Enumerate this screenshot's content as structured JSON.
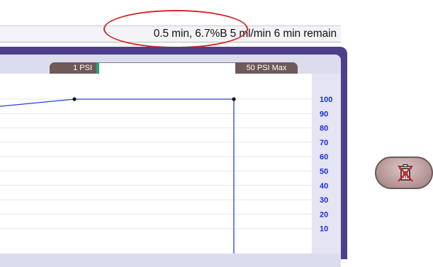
{
  "status": {
    "text": "0.5 min, 6.7%B 5 ml/min 6 min remain"
  },
  "pressure": {
    "current_label": "1 PSI",
    "max_label": "50 PSI Max",
    "fill_fraction": 0.02
  },
  "chart_data": {
    "type": "line",
    "yticks": [
      "100",
      "90",
      "80",
      "70",
      "60",
      "50",
      "40",
      "30",
      "20",
      "10"
    ],
    "ylim": [
      0,
      100
    ],
    "grid": true,
    "series": [
      {
        "points": [
          [
            0,
            95
          ],
          [
            105,
            100
          ],
          [
            330,
            100
          ],
          [
            330,
            0
          ]
        ]
      }
    ],
    "line_color": "#2a3ee8"
  },
  "controls": {
    "trash_icon": "delete-trash-icon"
  }
}
